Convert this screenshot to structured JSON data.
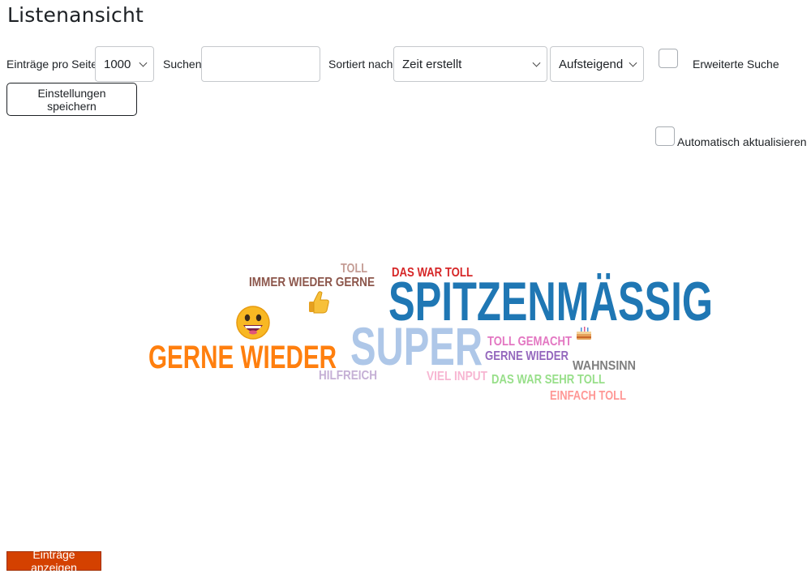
{
  "page": {
    "title": "Listenansicht"
  },
  "controls": {
    "per_page_label": "Einträge pro Seite",
    "per_page_value": "1000",
    "search_label": "Suchen",
    "search_value": "",
    "sort_label": "Sortiert nach",
    "sort_value": "Zeit erstellt",
    "order_value": "Aufsteigend",
    "advanced_search_label": "Erweiterte Suche",
    "save_settings_label": "Einstellungen speichern",
    "auto_refresh_label": "Automatisch aktualisieren"
  },
  "wordcloud": {
    "words": [
      {
        "text": "SPITZENMÄSSIG",
        "color": "#1f77b4"
      },
      {
        "text": "SUPER",
        "color": "#aec7e8"
      },
      {
        "text": "GERNE WIEDER",
        "color": "#ff7f0e"
      },
      {
        "text": "DAS WAR TOLL",
        "color": "#d62728"
      },
      {
        "text": "IMMER WIEDER GERNE",
        "color": "#8c564b"
      },
      {
        "text": "TOLL",
        "color": "#c49c94"
      },
      {
        "text": "TOLL GEMACHT",
        "color": "#e377c2"
      },
      {
        "text": "GERNE WIEDER",
        "color": "#9467bd"
      },
      {
        "text": "WAHNSINN",
        "color": "#7f7f7f"
      },
      {
        "text": "HILFREICH",
        "color": "#c5b0d5"
      },
      {
        "text": "VIEL INPUT",
        "color": "#f7b6d2"
      },
      {
        "text": "DAS WAR SEHR TOLL",
        "color": "#98df8a"
      },
      {
        "text": "EINFACH TOLL",
        "color": "#ff9896"
      }
    ],
    "icons": [
      "grinning-face-icon",
      "thumbs-up-icon",
      "birthday-cake-icon"
    ]
  },
  "footer": {
    "show_entries_label": "Einträge anzeigen"
  }
}
